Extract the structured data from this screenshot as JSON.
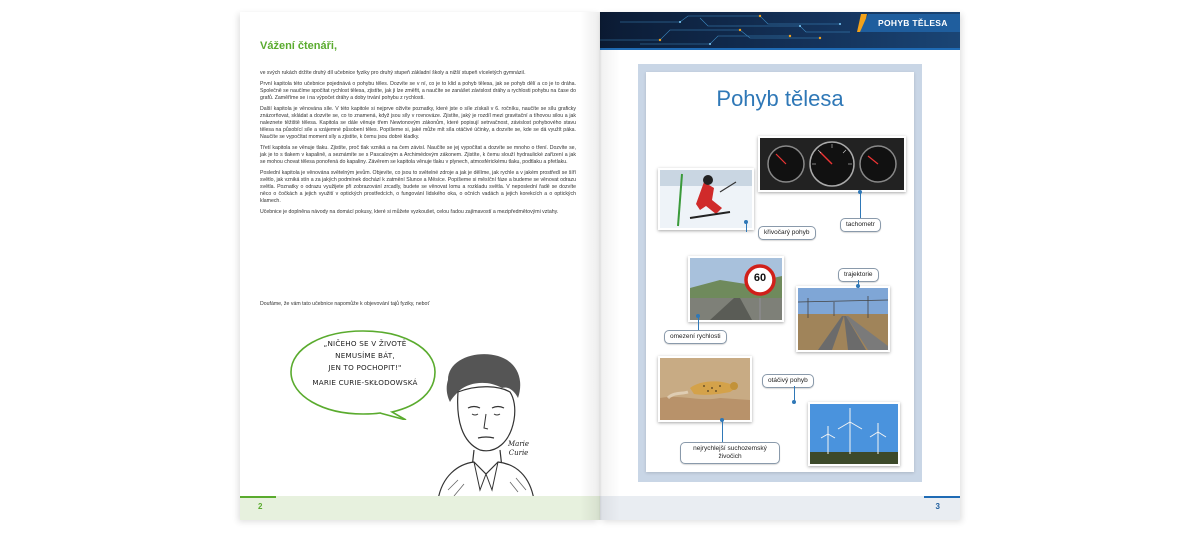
{
  "left_page": {
    "greeting": "Vážení čtenáři,",
    "paragraphs": [
      "ve svých rukách držíte druhý díl učebnice fyziky pro druhý stupeň základní školy a nižší stupeň víceletých gymnázií.",
      "První kapitola této učebnice pojednává o pohybu těles. Dozvíte se v ní, co je to klid a pohyb tělesa, jak se pohyb dělí a co je to dráha. Společně se naučíme spočítat rychlost tělesa, zjistíte, jak ji lze změřit, a naučíte se zanášet závislost dráhy a rychlosti pohybu na čase do grafů. Zaměříme se i na výpočet dráhy a doby trvání pohybu z rychlosti.",
      "Další kapitola je věnována síle. V této kapitole si nejprve oživíte poznatky, které jste o síle získali v 6. ročníku, naučíte se sílu graficky znázorňovat, skládat a dozvíte se, co to znamená, když jsou síly v rovnováze. Zjistíte, jaký je rozdíl mezi gravitační a tíhovou silou a jak naleznete těžiště tělesa. Kapitola se dále věnuje třem Newtonovým zákonům, které popisují setrvačnost, závislost pohybového stavu tělesa na působící síle a vzájemné působení těles. Popíšeme si, jaké může mít síla otáčivé účinky, a dozvíte se, kde se dá využít páka. Naučíte se vypočítat moment síly a zjistíte, k čemu jsou dobré kladky.",
      "Třetí kapitola se věnuje tlaku. Zjistíte, proč tlak vzniká a na čem závisí. Naučíte se jej vypočítat a dozvíte se mnoho o tření. Dozvíte se, jak je to s tlakem v kapalině, a seznámíte se s Pascalovým a Archimédovým zákonem. Zjistíte, k čemu slouží hydraulické zařízení a jak se mohou chovat tělesa ponořená do kapaliny. Závěrem se kapitola věnuje tlaku v plynech, atmosférickému tlaku, podtlaku a přetlaku.",
      "Poslední kapitola je věnována světelným jevům. Objevíte, co jsou to světelné zdroje a jak je dělíme, jak rychle a v jakém prostředí se šíří světlo, jak vzniká stín a za jakých podmínek dochází k zatmění Slunce a Měsíce. Popíšeme si měsíční fáze a budeme se věnovat odrazu světla. Poznatky o odrazu využijete při zobrazování zrcadly, budete se věnovat lomu a rozkladu světla. V neposlední řadě se dozvíte něco o čočkách a jejich využití v optických prostředcích, o fungování lidského oka, o očních vadách a jejich korekcích a o optických klamech.",
      "Učebnice je doplněna návody na domácí pokusy, které si můžete vyzkoušet, celou řadou zajímavostí a mezipředmětovými vztahy."
    ],
    "closing": "Doufáme, že vám tato učebnice napomůže k objevování tajů fyziky, neboť",
    "quote_lines": [
      "„NIČEHO SE V ŽIVOTĚ",
      "NEMUSÍME BÁT,",
      "JEN TO POCHOPIT!\""
    ],
    "quote_author": "MARIE CURIE-SKŁODOWSKÁ",
    "signature_lines": [
      "Marie",
      "Curie"
    ],
    "page_number": "2"
  },
  "right_page": {
    "header_label": "POHYB TĚLESA",
    "poster_title": "Pohyb tělesa",
    "labels": {
      "curved": "křivočarý pohyb",
      "tachometer": "tachometr",
      "trajectory": "trajektorie",
      "speed_limit": "omezení rychlosti",
      "rotational": "otáčivý pohyb",
      "fastest": "nejrychlejší suchozemský živočich"
    },
    "speed_sign": "60",
    "page_number": "3"
  },
  "colors": {
    "green_accent": "#5aab2e",
    "blue_accent": "#2f78b7",
    "header_dark": "#0b1b34",
    "header_label_bg": "#1f5e9e",
    "orange_accent": "#f3a21a"
  }
}
